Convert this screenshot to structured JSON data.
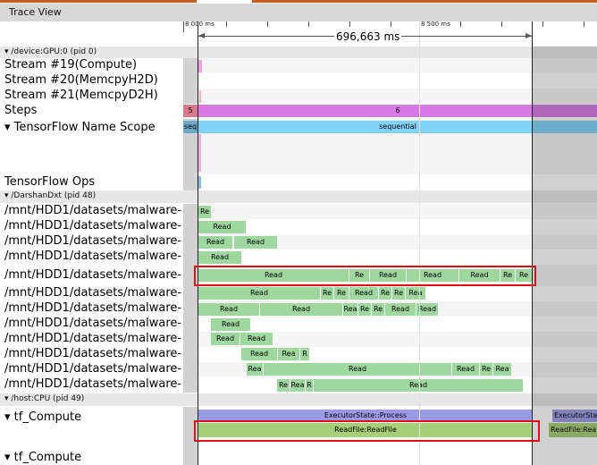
{
  "window": {
    "title": "Trace View"
  },
  "ruler": {
    "label_start": "8 000 ms",
    "label_mid": "8 500 ms",
    "measure": "696,663 ms"
  },
  "gpu": {
    "header": "▾ /device:GPU:0 (pid 0)",
    "streams": [
      "Stream #19(Compute)",
      "Stream #20(MemcpyH2D)",
      "Stream #21(MemcpyD2H)"
    ],
    "steps_label": "Steps",
    "steps_left_value": "5",
    "steps_value": "6",
    "scope_label": "▾  TensorFlow Name Scope",
    "scope_left_value": "seq",
    "scope_value": "sequential",
    "ops_label": "TensorFlow Ops"
  },
  "darshan": {
    "header": "▾ /DarshanDxt (pid 48)",
    "rows": [
      {
        "label": "/mnt/HDD1/datasets/malware-",
        "slices": [
          "Re"
        ]
      },
      {
        "label": "/mnt/HDD1/datasets/malware-",
        "slices": [
          "Read"
        ]
      },
      {
        "label": "/mnt/HDD1/datasets/malware-",
        "slices": [
          "Read",
          "Read"
        ]
      },
      {
        "label": "/mnt/HDD1/datasets/malware-",
        "slices": [
          "Read"
        ]
      },
      {
        "label": "/mnt/HDD1/datasets/malware-",
        "slices": [
          "Read",
          "Re",
          "Read",
          "Read",
          "Read",
          "Re",
          "Re"
        ]
      },
      {
        "label": "/mnt/HDD1/datasets/malware-",
        "slices": [
          "Read",
          "Re",
          "Re",
          "Read",
          "Re",
          "Re",
          "Rea"
        ]
      },
      {
        "label": "/mnt/HDD1/datasets/malware-",
        "slices": [
          "Read",
          "Read",
          "Rea",
          "Re",
          "Re",
          "Read",
          "Read"
        ]
      },
      {
        "label": "/mnt/HDD1/datasets/malware-",
        "slices": [
          "Read"
        ]
      },
      {
        "label": "/mnt/HDD1/datasets/malware-",
        "slices": [
          "Read",
          "Read"
        ]
      },
      {
        "label": "/mnt/HDD1/datasets/malware-",
        "slices": [
          "Read",
          "Rea",
          "R"
        ]
      },
      {
        "label": "/mnt/HDD1/datasets/malware-",
        "slices": [
          "Rea",
          "Read",
          "Read",
          "Re",
          "Rea"
        ]
      },
      {
        "label": "/mnt/HDD1/datasets/malware-",
        "slices": [
          "Re",
          "Rea",
          "R",
          "Read"
        ]
      }
    ]
  },
  "cpu": {
    "header": "▾ /host:CPU (pid 49)",
    "thread1": "▾  tf_Compute",
    "thread1_slice_top": "ExecutorState::Process",
    "thread1_slice_top_right": "ExecutorStat",
    "thread1_slice": "ReadFile:ReadFile",
    "thread1_slice_right": "ReadFile:Rea",
    "thread2": "▾  tf_Compute"
  },
  "colors": {
    "read_green": "#9ed89e",
    "executor_blue": "#9a9ae6",
    "readfile_green": "#a7cf77",
    "steps_magenta": "#d77ae6",
    "scope_blue": "#82d2f8",
    "highlight_red": "#e01010"
  }
}
